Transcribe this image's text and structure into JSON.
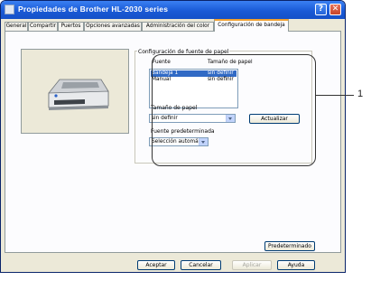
{
  "window": {
    "title": "Propiedades de Brother HL-2030 series",
    "help": "?",
    "close": "✕"
  },
  "tabs": [
    "General",
    "Compartir",
    "Puertos",
    "Opciones avanzadas",
    "Administración del color",
    "Configuración de bandeja"
  ],
  "group": {
    "title": "Configuración de fuente de papel",
    "col_source": "Fuente",
    "col_size": "Tamaño de papel",
    "rows": [
      {
        "source": "Bandeja 1",
        "size": "sin definir",
        "selected": true
      },
      {
        "source": "Manual",
        "size": "sin definir",
        "selected": false
      }
    ],
    "paper_size_label": "Tamaño de papel",
    "paper_size_value": "sin definir",
    "update_button": "Actualizar",
    "default_source_label": "Fuente predeterminada",
    "default_source_value": "Selección automática"
  },
  "defaults_button": "Predeterminado",
  "footer": {
    "ok": "Aceptar",
    "cancel": "Cancelar",
    "apply": "Aplicar",
    "help": "Ayuda"
  },
  "callout": "1",
  "colors": {
    "titlebar": "#1a5ad6",
    "selection": "#316ac5",
    "active_tab_accent": "#f0a030"
  }
}
